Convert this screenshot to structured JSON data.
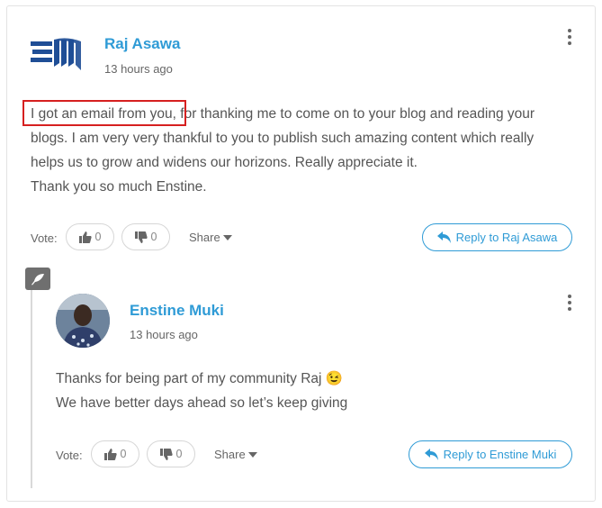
{
  "comment": {
    "author": "Raj Asawa",
    "time": "13 hours ago",
    "text_highlighted": "I got an email from you",
    "text_line1_rest": ", for thanking me to come on to your blog and reading your",
    "text_line2": "blogs. I am very very thankful to you to publish such amazing content which really",
    "text_line3": "helps us to grow and widens our horizons. Really appreciate it.",
    "text_line4": "Thank you so much Enstine.",
    "vote_label": "Vote:",
    "upvotes": "0",
    "downvotes": "0",
    "share_label": "Share",
    "reply_label": "Reply to Raj Asawa",
    "avatar_logo": "EM logo"
  },
  "reply": {
    "author": "Enstine Muki",
    "time": "13 hours ago",
    "text_line1": "Thanks for being part of my community Raj",
    "emoji": "😉",
    "text_line2": "We have better days ahead so let’s keep giving",
    "vote_label": "Vote:",
    "upvotes": "0",
    "downvotes": "0",
    "share_label": "Share",
    "reply_label": "Reply to Enstine Muki"
  },
  "colors": {
    "accent": "#2f9bd6",
    "highlight": "#d62020",
    "logo_blue": "#1f4e96"
  }
}
